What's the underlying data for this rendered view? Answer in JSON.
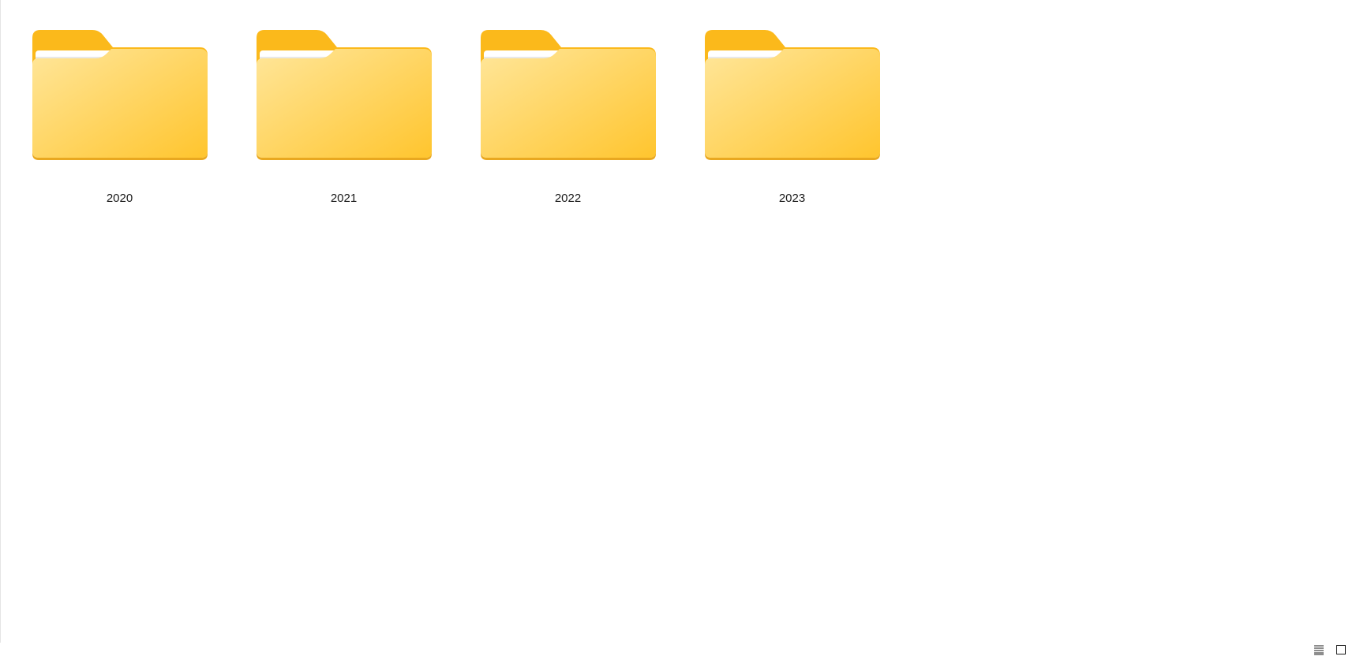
{
  "folders": [
    {
      "name": "2020",
      "icon": "folder-icon"
    },
    {
      "name": "2021",
      "icon": "folder-icon"
    },
    {
      "name": "2022",
      "icon": "folder-icon"
    },
    {
      "name": "2023",
      "icon": "folder-icon"
    }
  ],
  "status_bar": {
    "details_view_icon": "details-view-icon",
    "large_icons_view_icon": "large-icons-view-icon"
  },
  "colors": {
    "folder_back": "#FBB91B",
    "folder_front_light": "#FFE69A",
    "folder_front_dark": "#FFC836",
    "folder_edge": "#E9A820",
    "paper": "#FFFFFF"
  }
}
